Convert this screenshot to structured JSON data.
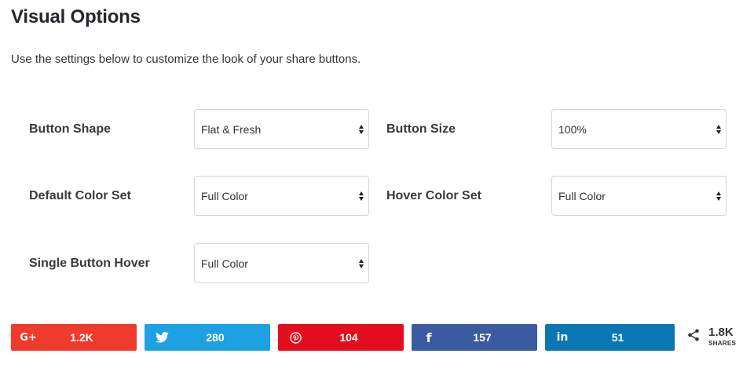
{
  "title": "Visual Options",
  "description": "Use the settings below to customize the look of your share buttons.",
  "fields": {
    "button_shape": {
      "label": "Button Shape",
      "value": "Flat & Fresh"
    },
    "button_size": {
      "label": "Button Size",
      "value": "100%"
    },
    "default_color_set": {
      "label": "Default Color Set",
      "value": "Full Color"
    },
    "hover_color_set": {
      "label": "Hover Color Set",
      "value": "Full Color"
    },
    "single_button_hover": {
      "label": "Single Button Hover",
      "value": "Full Color"
    }
  },
  "share_buttons": [
    {
      "network": "Google+",
      "icon": "google-plus-icon",
      "icon_text": "G+",
      "count": "1.2K",
      "color": "#ee3b2b"
    },
    {
      "network": "Twitter",
      "icon": "twitter-icon",
      "count": "280",
      "color": "#1da1e2"
    },
    {
      "network": "Pinterest",
      "icon": "pinterest-icon",
      "count": "104",
      "color": "#e20e1e"
    },
    {
      "network": "Facebook",
      "icon": "facebook-icon",
      "icon_text": "f",
      "count": "157",
      "color": "#3a5ba2"
    },
    {
      "network": "LinkedIn",
      "icon": "linkedin-icon",
      "icon_text": "in",
      "count": "51",
      "color": "#0a77b5"
    }
  ],
  "total_shares": {
    "count": "1.8K",
    "label": "SHARES",
    "icon": "share-icon"
  }
}
